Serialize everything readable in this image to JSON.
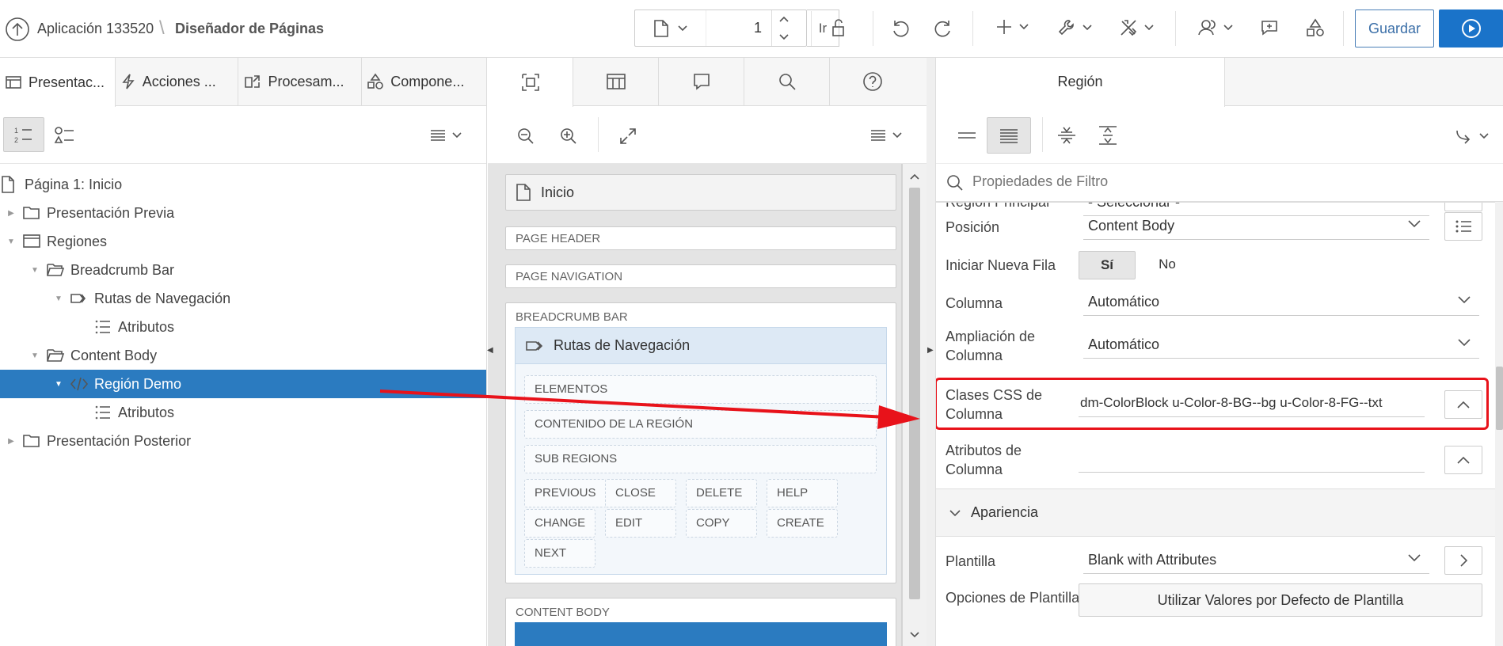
{
  "header": {
    "app_name": "Aplicación 133520",
    "separator": "\\",
    "page_designer": "Diseñador de Páginas",
    "page_number": "1",
    "go_label": "Ir",
    "save_label": "Guardar"
  },
  "left_tabs": [
    "Presentac...",
    "Acciones ...",
    "Procesam...",
    "Compone..."
  ],
  "tree": [
    {
      "label": "Página 1: Inicio",
      "indent": 0,
      "toggle": "",
      "icon": "page-icon"
    },
    {
      "label": "Presentación Previa",
      "indent": 1,
      "toggle": "▶",
      "icon": "folder-icon"
    },
    {
      "label": "Regiones",
      "indent": 1,
      "toggle": "▼",
      "icon": "region-icon"
    },
    {
      "label": "Breadcrumb Bar",
      "indent": 2,
      "toggle": "▼",
      "icon": "folder-open-icon"
    },
    {
      "label": "Rutas de Navegación",
      "indent": 3,
      "toggle": "▼",
      "icon": "breadcrumb-icon"
    },
    {
      "label": "Atributos",
      "indent": 4,
      "toggle": "",
      "icon": "list-icon"
    },
    {
      "label": "Content Body",
      "indent": 2,
      "toggle": "▼",
      "icon": "folder-open-icon"
    },
    {
      "label": "Región Demo",
      "indent": 3,
      "toggle": "▼",
      "icon": "code-icon",
      "selected": true
    },
    {
      "label": "Atributos",
      "indent": 4,
      "toggle": "",
      "icon": "list-icon"
    },
    {
      "label": "Presentación Posterior",
      "indent": 1,
      "toggle": "▶",
      "icon": "folder-icon"
    }
  ],
  "layout": {
    "page_label": "Inicio",
    "page_header": "PAGE HEADER",
    "page_navigation": "PAGE NAVIGATION",
    "breadcrumb_bar": "BREADCRUMB BAR",
    "breadcrumb_region": "Rutas de Navegación",
    "slots": [
      "ELEMENTOS",
      "CONTENIDO DE LA REGIÓN",
      "SUB REGIONS"
    ],
    "buttons": [
      "PREVIOUS",
      "CLOSE",
      "DELETE",
      "HELP",
      "CHANGE",
      "EDIT",
      "COPY",
      "CREATE",
      "NEXT"
    ],
    "content_body": "CONTENT BODY"
  },
  "properties": {
    "tab_label": "Región",
    "filter_placeholder": "Propiedades de Filtro",
    "partial_label": "Región Principal",
    "partial_value": "- Seleccionar -",
    "rows": [
      {
        "label": "Posición",
        "value": "Content Body"
      },
      {
        "label": "Iniciar Nueva Fila",
        "yes": "Sí",
        "no": "No"
      },
      {
        "label": "Columna",
        "value": "Automático"
      },
      {
        "label": "Ampliación de Columna",
        "value": "Automático"
      },
      {
        "label": "Clases CSS de Columna",
        "value": "dm-ColorBlock u-Color-8-BG--bg u-Color-8-FG--txt"
      },
      {
        "label": "Atributos de Columna",
        "value": ""
      }
    ],
    "section_title": "Apariencia",
    "template_label": "Plantilla",
    "template_value": "Blank with Attributes",
    "template_options_label": "Opciones de Plantilla",
    "template_options_button": "Utilizar Valores por Defecto de Plantilla"
  },
  "colors": {
    "accent": "#1a73c9",
    "selected_row": "#2b7bc0",
    "highlight_red": "#e8121a"
  }
}
